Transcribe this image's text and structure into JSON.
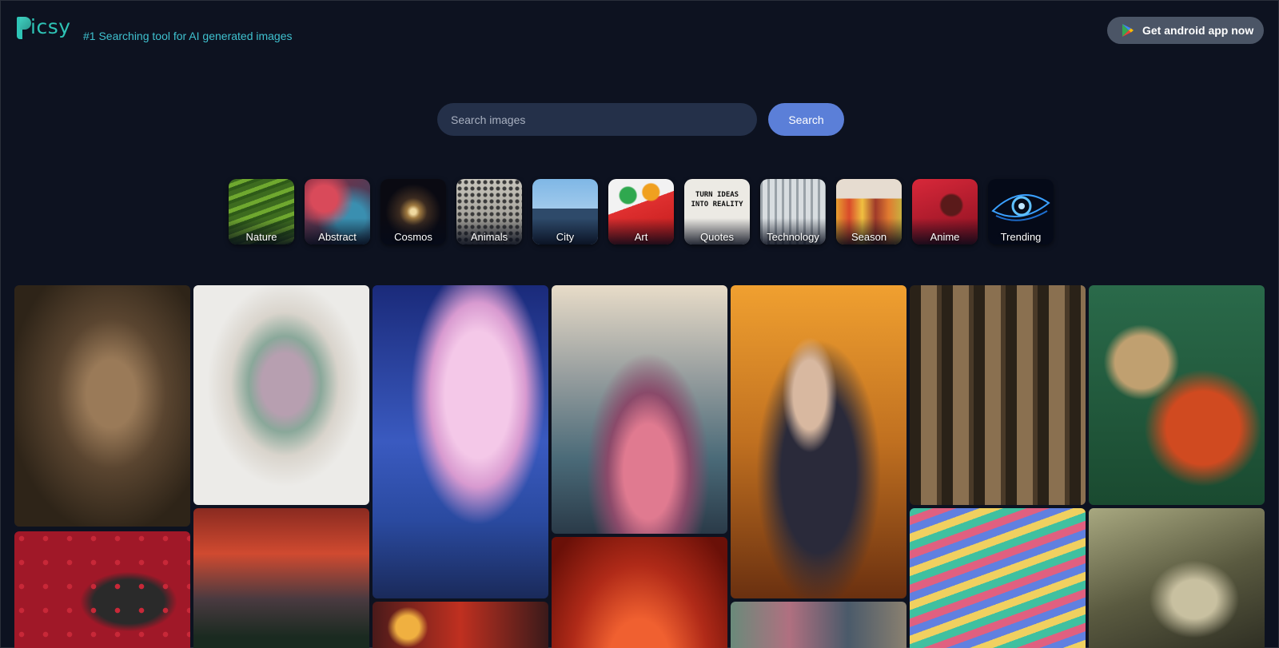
{
  "header": {
    "logo_text": "icsy",
    "tagline": "#1 Searching tool for AI generated images",
    "android_button": "Get android app now"
  },
  "search": {
    "placeholder": "Search images",
    "button": "Search"
  },
  "categories": [
    {
      "label": "Nature"
    },
    {
      "label": "Abstract"
    },
    {
      "label": "Cosmos"
    },
    {
      "label": "Animals"
    },
    {
      "label": "City"
    },
    {
      "label": "Art"
    },
    {
      "label": "Quotes",
      "sign_text": "TURN IDEAS INTO REALITY"
    },
    {
      "label": "Technology"
    },
    {
      "label": "Season"
    },
    {
      "label": "Anime"
    },
    {
      "label": "Trending"
    }
  ],
  "colors": {
    "background": "#0d1220",
    "accent": "#5b7fd8",
    "brand": "#2ec4b6"
  },
  "gallery_icon": "image-thumbnail"
}
